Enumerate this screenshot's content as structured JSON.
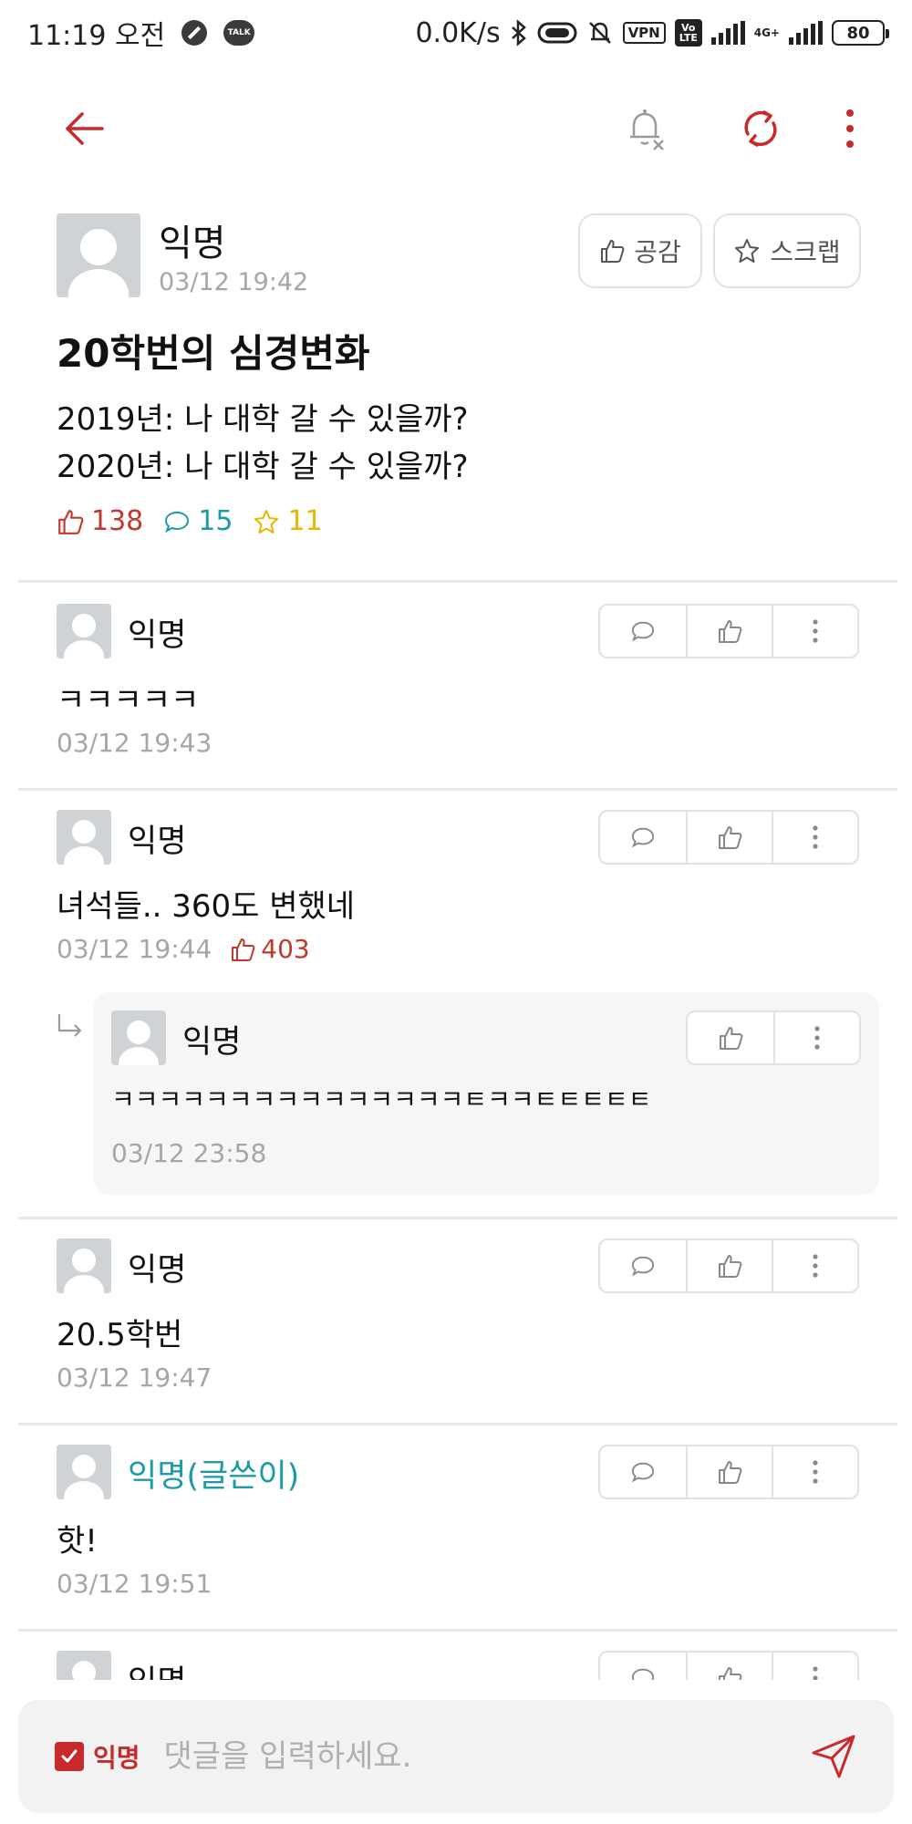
{
  "status_bar": {
    "time": "11:19 오전",
    "talk_badge": "TALK",
    "net_speed": "0.0K/s",
    "vpn": "VPN",
    "volte": "Vo LTE",
    "network": "4G+",
    "battery": "80"
  },
  "appbar": {
    "icons": [
      "back-arrow-icon",
      "notification-off-icon",
      "refresh-icon",
      "more-vertical-icon"
    ],
    "accent_color": "#c62a2a"
  },
  "post": {
    "author": "익명",
    "time": "03/12 19:42",
    "like_button": "공감",
    "scrap_button": "스크랩",
    "title": "20학번의 심경변화",
    "body": "2019년: 나 대학 갈 수 있을까?\n2020년: 나 대학 갈 수 있을까?",
    "likes": "138",
    "comments": "15",
    "scraps": "11"
  },
  "comments": [
    {
      "author": "익명",
      "text": "ㅋㅋㅋㅋㅋ",
      "time": "03/12 19:43",
      "likes": ""
    },
    {
      "author": "익명",
      "text": "녀석들.. 360도 변했네",
      "time": "03/12 19:44",
      "likes": "403"
    },
    {
      "author": "익명",
      "text": "ㅋㅋㅋㅋㅋㅋㅋㅋㅋㅋㅋㅋㅋㅋㅋㅌㅋㅋㅌㅌㅌㅌㅌ",
      "time": "03/12 23:58",
      "likes": "",
      "is_reply": true
    },
    {
      "author": "익명",
      "text": "20.5학번",
      "time": "03/12 19:47",
      "likes": ""
    },
    {
      "author": "익명(글쓴이)",
      "text": "핫!",
      "time": "03/12 19:51",
      "likes": "",
      "is_op": true
    },
    {
      "author": "익명",
      "text": "",
      "time": "",
      "likes": "",
      "partial": true
    }
  ],
  "composer": {
    "anonymous_label": "익명",
    "anonymous_checked": true,
    "placeholder": "댓글을 입력하세요."
  }
}
